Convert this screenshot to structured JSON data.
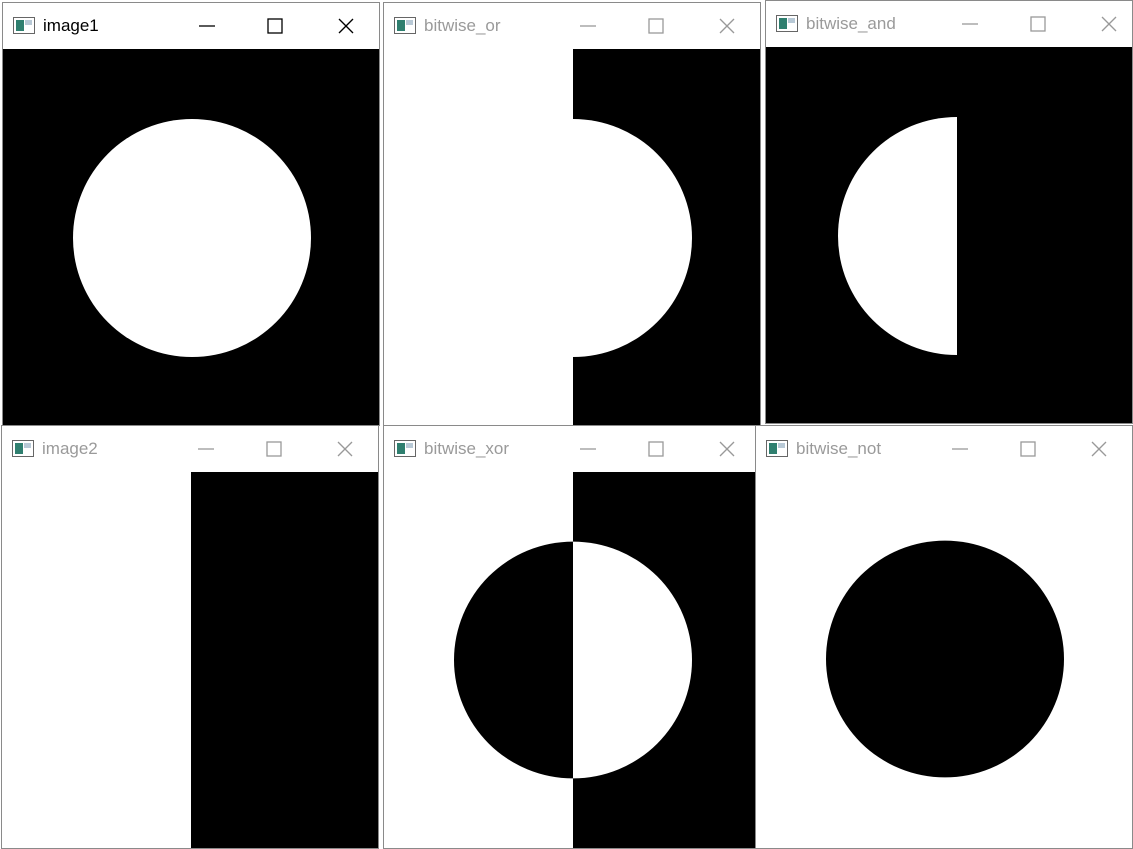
{
  "windows": [
    {
      "id": "image1",
      "title": "image1",
      "active": true
    },
    {
      "id": "bitwise_or",
      "title": "bitwise_or",
      "active": false
    },
    {
      "id": "bitwise_and",
      "title": "bitwise_and",
      "active": false
    },
    {
      "id": "image2",
      "title": "image2",
      "active": false
    },
    {
      "id": "bitwise_xor",
      "title": "bitwise_xor",
      "active": false
    },
    {
      "id": "bitwise_not",
      "title": "bitwise_not",
      "active": false
    }
  ],
  "colors": {
    "ink": "#000000",
    "paper": "#ffffff",
    "inactive_text": "#9a9a9a",
    "icon_teal": "#2f7f6f"
  },
  "icons": {
    "app": "app-window-icon",
    "minimize": "minimize-icon",
    "maximize": "maximize-icon",
    "close": "close-icon"
  }
}
